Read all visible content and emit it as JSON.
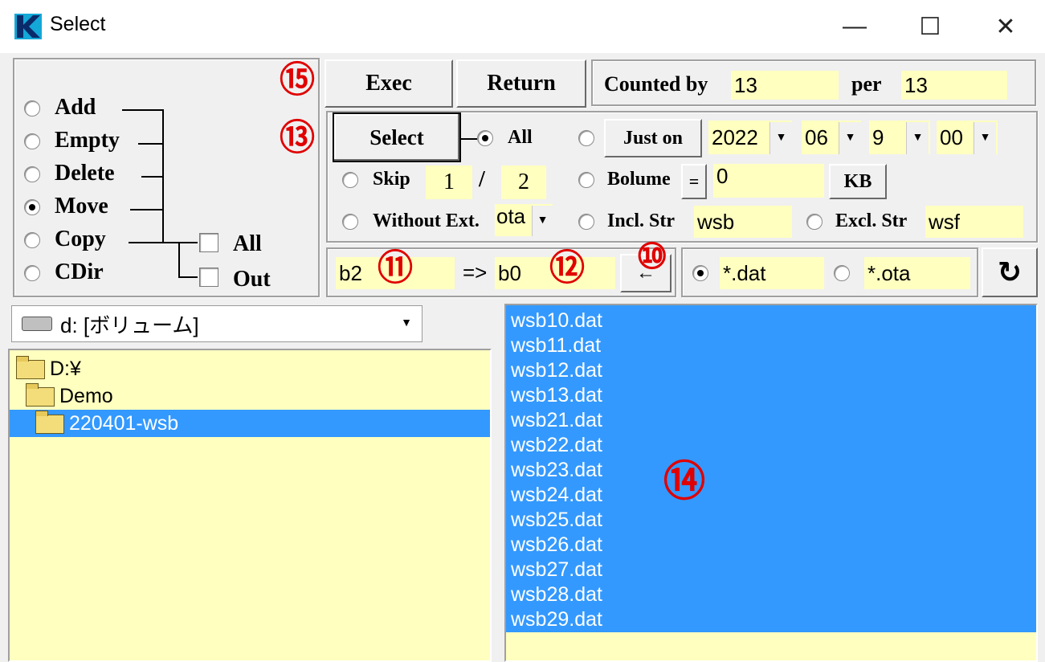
{
  "window": {
    "title": "Select",
    "minimize": "—",
    "maximize": "☐",
    "close": "✕"
  },
  "mode": {
    "options": [
      "Add",
      "Empty",
      "Delete",
      "Move",
      "Copy",
      "CDir"
    ],
    "selected": "Move",
    "checks": [
      "All",
      "Out"
    ]
  },
  "toolbar": {
    "exec": "Exec",
    "return": "Return",
    "counted_by_label": "Counted by",
    "counted_by_value": "13",
    "per_label": "per",
    "per_value": "13"
  },
  "select": {
    "select_button": "Select",
    "all_label": "All",
    "just_on_button": "Just on",
    "year": "2022",
    "month": "06",
    "day": "9",
    "hour": "00",
    "skip_label": "Skip",
    "skip_a": "1",
    "skip_slash": "/",
    "skip_b": "2",
    "bolume_label": "Bolume",
    "bolume_op": "=",
    "bolume_value": "0",
    "kb_button": "KB",
    "without_ext_label": "Without Ext.",
    "without_ext_value": "ota",
    "incl_label": "Incl. Str",
    "incl_value": "wsb",
    "excl_label": "Excl. Str",
    "excl_value": "wsf"
  },
  "rename": {
    "from": "b2",
    "arrow": "=>",
    "to": "b0",
    "back_button": "←",
    "pattern_a": "*.dat",
    "pattern_b": "*.ota",
    "refresh": "↻"
  },
  "drive": {
    "label": "d: [ボリューム]"
  },
  "tree": [
    {
      "label": "D:¥",
      "depth": 0,
      "selected": false
    },
    {
      "label": "Demo",
      "depth": 1,
      "selected": false
    },
    {
      "label": "220401-wsb",
      "depth": 2,
      "selected": true
    }
  ],
  "files": [
    "wsb10.dat",
    "wsb11.dat",
    "wsb12.dat",
    "wsb13.dat",
    "wsb21.dat",
    "wsb22.dat",
    "wsb23.dat",
    "wsb24.dat",
    "wsb25.dat",
    "wsb26.dat",
    "wsb27.dat",
    "wsb28.dat",
    "wsb29.dat"
  ],
  "annotations": {
    "n15": "⑮",
    "n13": "⑬",
    "n11": "⑪",
    "n12": "⑫",
    "n10": "⑩",
    "n14": "⑭"
  },
  "colors": {
    "field_bg": "#ffffc0",
    "selection": "#3399ff",
    "annotation": "#e00000"
  }
}
